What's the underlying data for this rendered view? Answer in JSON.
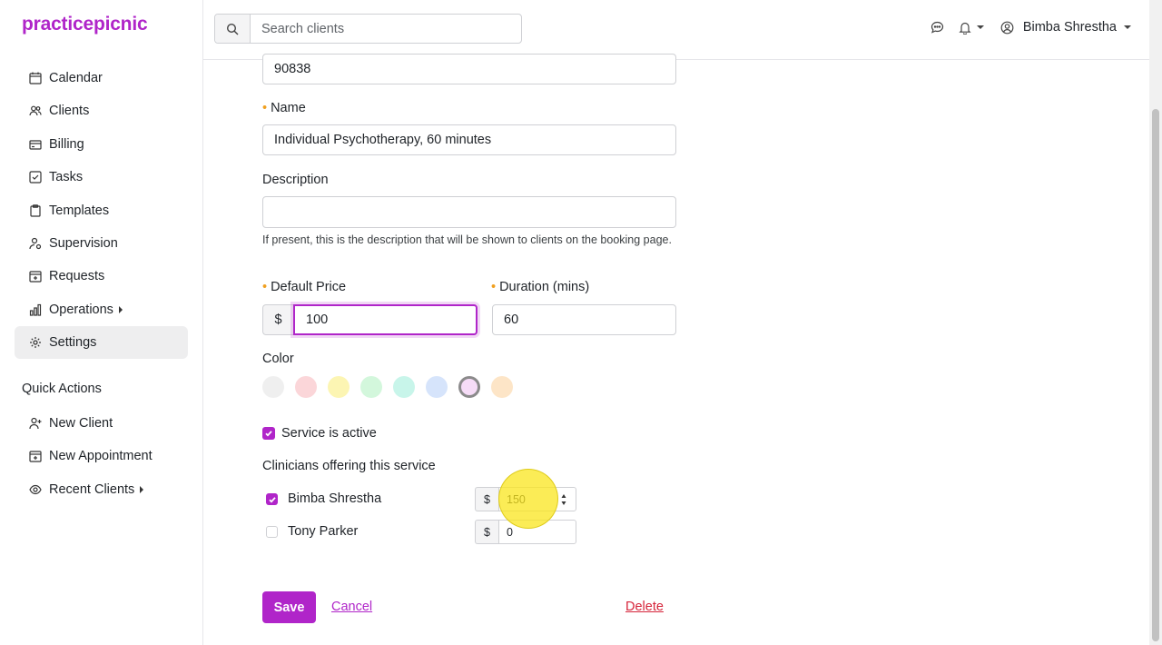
{
  "app": {
    "logo": "practicepicnic"
  },
  "sidebar": {
    "items": [
      {
        "label": "Calendar",
        "icon": "calendar-icon"
      },
      {
        "label": "Clients",
        "icon": "users-icon"
      },
      {
        "label": "Billing",
        "icon": "credit-card-icon"
      },
      {
        "label": "Tasks",
        "icon": "checkbox-icon"
      },
      {
        "label": "Templates",
        "icon": "clipboard-icon"
      },
      {
        "label": "Supervision",
        "icon": "user-cog-icon"
      },
      {
        "label": "Requests",
        "icon": "calendar-plus-icon"
      },
      {
        "label": "Operations",
        "icon": "bar-chart-icon"
      },
      {
        "label": "Settings",
        "icon": "gear-icon",
        "active": true
      }
    ],
    "quick_actions_title": "Quick Actions",
    "quick_actions": [
      {
        "label": "New Client",
        "icon": "user-plus-icon"
      },
      {
        "label": "New Appointment",
        "icon": "calendar-plus-icon"
      },
      {
        "label": "Recent Clients",
        "icon": "eye-icon"
      }
    ]
  },
  "topbar": {
    "search_placeholder": "Search clients",
    "user_name": "Bimba Shrestha"
  },
  "form": {
    "code_value": "90838",
    "name_label": "Name",
    "name_value": "Individual Psychotherapy, 60 minutes",
    "description_label": "Description",
    "description_value": "",
    "description_help": "If present, this is the description that will be shown to clients on the booking page.",
    "price_label": "Default Price",
    "currency": "$",
    "price_value": "100",
    "duration_label": "Duration (mins)",
    "duration_value": "60",
    "color_label": "Color",
    "colors": [
      "#efefef",
      "#fbd6d9",
      "#fcf5b3",
      "#d3f7dc",
      "#c8f5ea",
      "#d6e4fb",
      "#f6dcf7",
      "#fde5c7"
    ],
    "selected_color_index": 6,
    "active_label": "Service is active",
    "active_checked": true,
    "clinicians_title": "Clinicians offering this service",
    "clinicians": [
      {
        "name": "Bimba Shrestha",
        "checked": true,
        "rate": "150"
      },
      {
        "name": "Tony Parker",
        "checked": false,
        "rate": "0"
      }
    ],
    "save_label": "Save",
    "cancel_label": "Cancel",
    "delete_label": "Delete"
  }
}
